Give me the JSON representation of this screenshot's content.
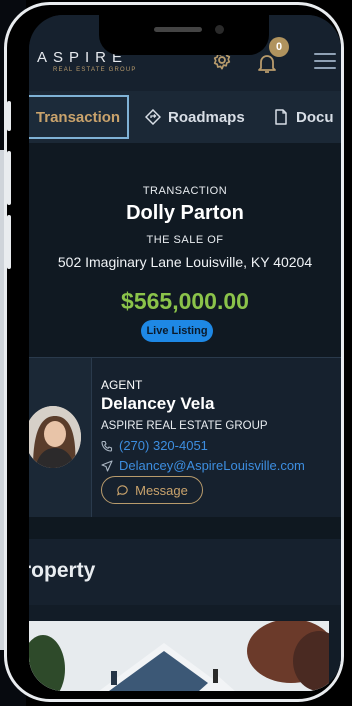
{
  "header": {
    "logo_main": "ASPIRE",
    "logo_sub": "REAL ESTATE GROUP",
    "notification_count": "0"
  },
  "tabs": [
    {
      "label": "Transaction",
      "active": true
    },
    {
      "label": "Roadmaps",
      "active": false
    },
    {
      "label": "Docu",
      "active": false
    }
  ],
  "transaction": {
    "eyebrow": "TRANSACTION",
    "client_name": "Dolly Parton",
    "sale_label": "THE SALE OF",
    "address": "502 Imaginary Lane Louisville, KY 40204",
    "price": "$565,000.00",
    "status": "Live Listing"
  },
  "agent": {
    "label": "AGENT",
    "name": "Delancey Vela",
    "company": "ASPIRE REAL ESTATE GROUP",
    "phone": "(270) 320-4051",
    "email": "Delancey@AspireLouisville.com",
    "message_label": "Message"
  },
  "property": {
    "title": "roperty"
  },
  "colors": {
    "accent_gold": "#b89b6c",
    "price_green": "#8bc34a",
    "link_blue": "#3d8ee0",
    "pill_blue": "#1e88e5",
    "bg_dark": "#121c27"
  }
}
